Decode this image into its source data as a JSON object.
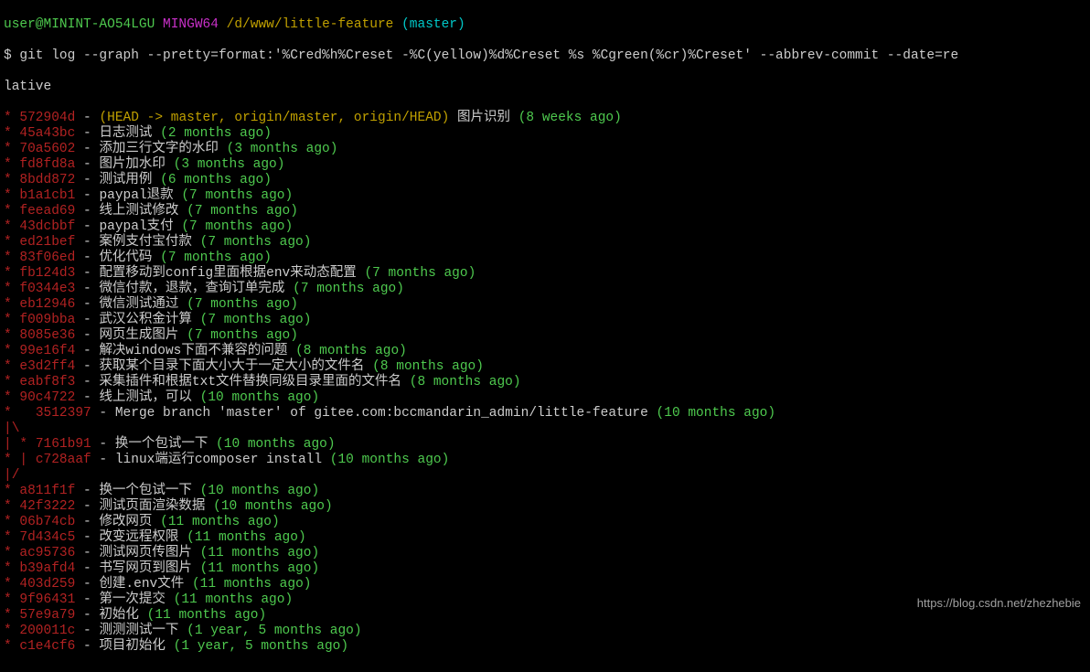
{
  "prompt": {
    "user": "user@MININT-AO54LGU",
    "mingw": "MINGW64",
    "path": "/d/www/little-feature",
    "branch": "(master)"
  },
  "command": "$ git log --graph --pretty=format:'%Cred%h%Creset -%C(yellow)%d%Creset %s %Cgreen(%cr)%Creset' --abbrev-commit --date=re",
  "command_wrap": "lative",
  "commits": [
    {
      "graph": "* ",
      "hash": "572904d",
      "sep": " - ",
      "refs": "(HEAD -> master, origin/master, origin/HEAD)",
      "msg": " 图片识别 ",
      "time": "(8 weeks ago)"
    },
    {
      "graph": "* ",
      "hash": "45a43bc",
      "sep": " - ",
      "refs": "",
      "msg": "日志测试 ",
      "time": "(2 months ago)"
    },
    {
      "graph": "* ",
      "hash": "70a5602",
      "sep": " - ",
      "refs": "",
      "msg": "添加三行文字的水印 ",
      "time": "(3 months ago)"
    },
    {
      "graph": "* ",
      "hash": "fd8fd8a",
      "sep": " - ",
      "refs": "",
      "msg": "图片加水印 ",
      "time": "(3 months ago)"
    },
    {
      "graph": "* ",
      "hash": "8bdd872",
      "sep": " - ",
      "refs": "",
      "msg": "测试用例 ",
      "time": "(6 months ago)"
    },
    {
      "graph": "* ",
      "hash": "b1a1cb1",
      "sep": " - ",
      "refs": "",
      "msg": "paypal退款 ",
      "time": "(7 months ago)"
    },
    {
      "graph": "* ",
      "hash": "feead69",
      "sep": " - ",
      "refs": "",
      "msg": "线上测试修改 ",
      "time": "(7 months ago)"
    },
    {
      "graph": "* ",
      "hash": "43dcbbf",
      "sep": " - ",
      "refs": "",
      "msg": "paypal支付 ",
      "time": "(7 months ago)"
    },
    {
      "graph": "* ",
      "hash": "ed21bef",
      "sep": " - ",
      "refs": "",
      "msg": "案例支付宝付款 ",
      "time": "(7 months ago)"
    },
    {
      "graph": "* ",
      "hash": "83f06ed",
      "sep": " - ",
      "refs": "",
      "msg": "优化代码 ",
      "time": "(7 months ago)"
    },
    {
      "graph": "* ",
      "hash": "fb124d3",
      "sep": " - ",
      "refs": "",
      "msg": "配置移动到config里面根据env来动态配置 ",
      "time": "(7 months ago)"
    },
    {
      "graph": "* ",
      "hash": "f0344e3",
      "sep": " - ",
      "refs": "",
      "msg": "微信付款，退款，查询订单完成 ",
      "time": "(7 months ago)"
    },
    {
      "graph": "* ",
      "hash": "eb12946",
      "sep": " - ",
      "refs": "",
      "msg": "微信测试通过 ",
      "time": "(7 months ago)"
    },
    {
      "graph": "* ",
      "hash": "f009bba",
      "sep": " - ",
      "refs": "",
      "msg": "武汉公积金计算 ",
      "time": "(7 months ago)"
    },
    {
      "graph": "* ",
      "hash": "8085e36",
      "sep": " - ",
      "refs": "",
      "msg": "网页生成图片 ",
      "time": "(7 months ago)"
    },
    {
      "graph": "* ",
      "hash": "99e16f4",
      "sep": " - ",
      "refs": "",
      "msg": "解决windows下面不兼容的问题 ",
      "time": "(8 months ago)"
    },
    {
      "graph": "* ",
      "hash": "e3d2ff4",
      "sep": " - ",
      "refs": "",
      "msg": "获取某个目录下面大小大于一定大小的文件名 ",
      "time": "(8 months ago)"
    },
    {
      "graph": "* ",
      "hash": "eabf8f3",
      "sep": " - ",
      "refs": "",
      "msg": "采集插件和根据txt文件替换同级目录里面的文件名 ",
      "time": "(8 months ago)"
    },
    {
      "graph": "* ",
      "hash": "90c4722",
      "sep": " - ",
      "refs": "",
      "msg": "线上测试，可以 ",
      "time": "(10 months ago)"
    },
    {
      "graph": "*   ",
      "hash": "3512397",
      "sep": " - ",
      "refs": "",
      "msg": "Merge branch 'master' of gitee.com:bccmandarin_admin/little-feature ",
      "time": "(10 months ago)"
    },
    {
      "graph_literal": true,
      "text": "|\\"
    },
    {
      "graph": "| * ",
      "hash": "7161b91",
      "sep": " - ",
      "refs": "",
      "msg": "换一个包试一下 ",
      "time": "(10 months ago)"
    },
    {
      "graph": "* | ",
      "hash": "c728aaf",
      "sep": " - ",
      "refs": "",
      "msg": "linux端运行composer install ",
      "time": "(10 months ago)"
    },
    {
      "graph_literal": true,
      "text": "|/"
    },
    {
      "graph": "* ",
      "hash": "a811f1f",
      "sep": " - ",
      "refs": "",
      "msg": "换一个包试一下 ",
      "time": "(10 months ago)"
    },
    {
      "graph": "* ",
      "hash": "42f3222",
      "sep": " - ",
      "refs": "",
      "msg": "测试页面渲染数据 ",
      "time": "(10 months ago)"
    },
    {
      "graph": "* ",
      "hash": "06b74cb",
      "sep": " - ",
      "refs": "",
      "msg": "修改网页 ",
      "time": "(11 months ago)"
    },
    {
      "graph": "* ",
      "hash": "7d434c5",
      "sep": " - ",
      "refs": "",
      "msg": "改变远程权限 ",
      "time": "(11 months ago)"
    },
    {
      "graph": "* ",
      "hash": "ac95736",
      "sep": " - ",
      "refs": "",
      "msg": "测试网页传图片 ",
      "time": "(11 months ago)"
    },
    {
      "graph": "* ",
      "hash": "b39afd4",
      "sep": " - ",
      "refs": "",
      "msg": "书写网页到图片 ",
      "time": "(11 months ago)"
    },
    {
      "graph": "* ",
      "hash": "403d259",
      "sep": " - ",
      "refs": "",
      "msg": "创建.env文件 ",
      "time": "(11 months ago)"
    },
    {
      "graph": "* ",
      "hash": "9f96431",
      "sep": " - ",
      "refs": "",
      "msg": "第一次提交 ",
      "time": "(11 months ago)"
    },
    {
      "graph": "* ",
      "hash": "57e9a79",
      "sep": " - ",
      "refs": "",
      "msg": "初始化 ",
      "time": "(11 months ago)"
    },
    {
      "graph": "* ",
      "hash": "200011c",
      "sep": " - ",
      "refs": "",
      "msg": "测测测试一下 ",
      "time": "(1 year, 5 months ago)"
    },
    {
      "graph": "* ",
      "hash": "c1e4cf6",
      "sep": " - ",
      "refs": "",
      "msg": "项目初始化 ",
      "time": "(1 year, 5 months ago)"
    }
  ],
  "watermark": "https://blog.csdn.net/zhezhebie"
}
